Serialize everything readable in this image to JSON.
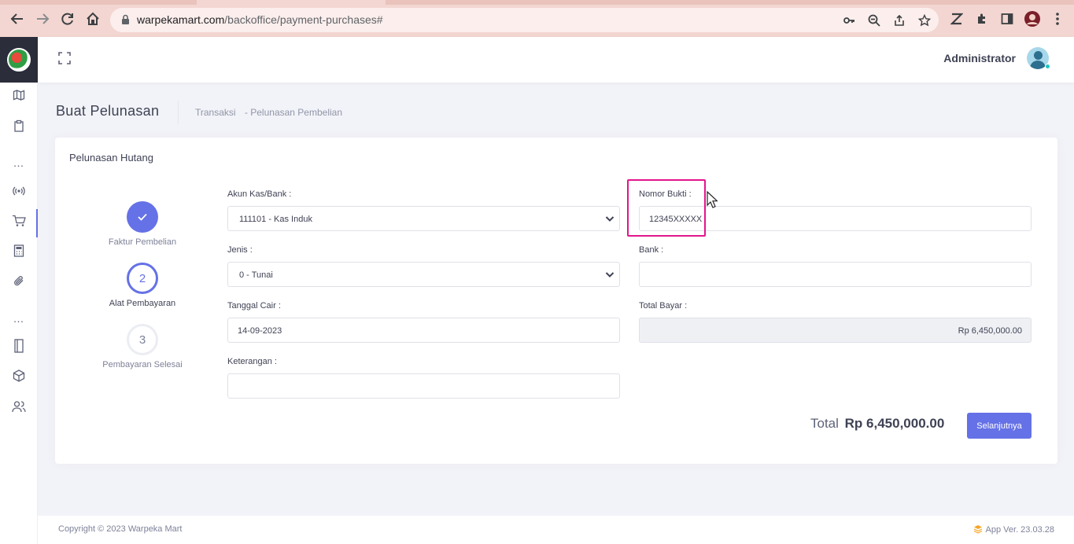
{
  "browser": {
    "url_host": "warpekamart.com",
    "url_path": "/backoffice/payment-purchases#"
  },
  "header": {
    "user_name": "Administrator"
  },
  "subheader": {
    "title": "Buat Pelunasan",
    "breadcrumb": [
      "Transaksi",
      "- Pelunasan Pembelian"
    ]
  },
  "card": {
    "title": "Pelunasan Hutang"
  },
  "steps": [
    {
      "number": "",
      "label": "Faktur Pembelian",
      "state": "done"
    },
    {
      "number": "2",
      "label": "Alat Pembayaran",
      "state": "current"
    },
    {
      "number": "3",
      "label": "Pembayaran Selesai",
      "state": "todo"
    }
  ],
  "form": {
    "akun": {
      "label": "Akun Kas/Bank :",
      "value": "111101 - Kas Induk"
    },
    "nomor_bukti": {
      "label": "Nomor Bukti :",
      "value": "12345XXXXX"
    },
    "jenis": {
      "label": "Jenis :",
      "value": "0 - Tunai"
    },
    "bank": {
      "label": "Bank :",
      "value": ""
    },
    "tanggal_cair": {
      "label": "Tanggal Cair :",
      "value": "14-09-2023"
    },
    "total_bayar": {
      "label": "Total Bayar :",
      "value": "Rp 6,450,000.00"
    },
    "keterangan": {
      "label": "Keterangan :",
      "value": ""
    }
  },
  "summary": {
    "total_label": "Total",
    "total_amount": "Rp 6,450,000.00",
    "next_button": "Selanjutnya"
  },
  "footer": {
    "copyright": "Copyright © 2023 Warpeka Mart",
    "version": "App Ver. 23.03.28"
  },
  "colors": {
    "accent": "#6571e6",
    "highlight": "#e3158c",
    "chrome": "#f3d6d1"
  }
}
